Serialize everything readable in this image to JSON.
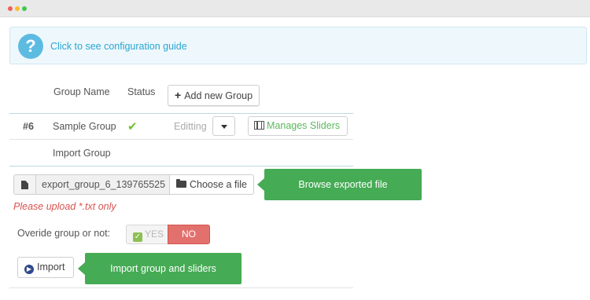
{
  "colors": {
    "accent_blue": "#2aa5d3",
    "success_green": "#5bb85d",
    "callout_green": "#45ab54",
    "danger_red": "#d9534f"
  },
  "guide": {
    "link_text": "Click to see configuration guide",
    "icon": "question-icon"
  },
  "table": {
    "headers": {
      "group_name": "Group Name",
      "status": "Status"
    },
    "add_button": "Add new Group",
    "rows": [
      {
        "id": "#6",
        "name": "Sample Group",
        "status_icon": "check-icon",
        "state": "Editting",
        "manage_label": "Manages Sliders"
      }
    ],
    "import_row_label": "Import Group"
  },
  "import": {
    "file_name": "export_group_6_139765525",
    "choose_button": "Choose a file",
    "warning": "Please upload *.txt only",
    "override_label": "Overide group or not:",
    "toggle_yes": "YES",
    "toggle_no": "NO",
    "toggle_selected": "NO",
    "import_button": "Import"
  },
  "callouts": {
    "browse": "Browse exported file",
    "import": "Import group and sliders"
  }
}
